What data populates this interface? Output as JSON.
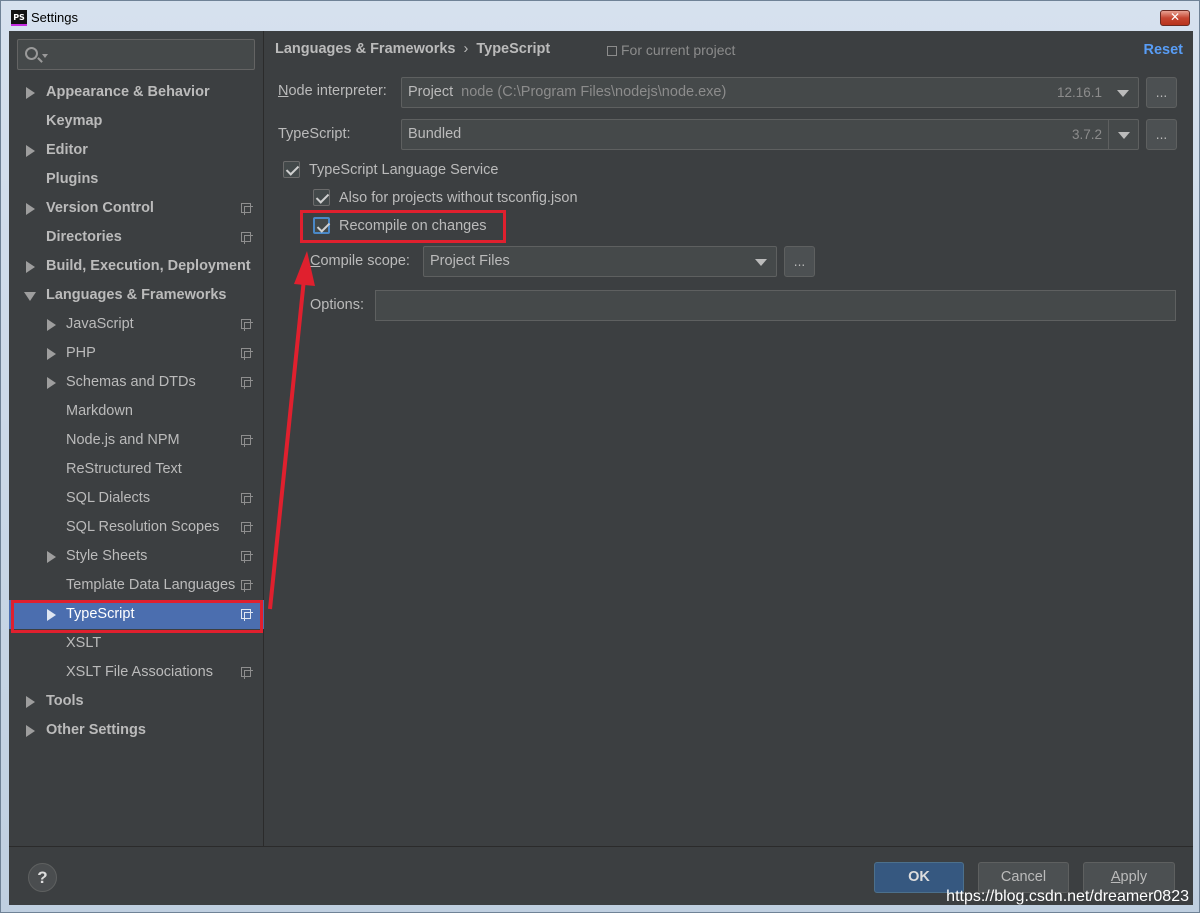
{
  "window": {
    "title": "Settings",
    "app_logo": "PS",
    "close_glyph": "✕"
  },
  "search": {
    "placeholder": "",
    "icon": "search-icon"
  },
  "sidebar": {
    "items": [
      {
        "label": "Appearance & Behavior",
        "expander": "collapsed",
        "project": false,
        "selected": false
      },
      {
        "label": "Keymap",
        "expander": "none",
        "project": false,
        "selected": false
      },
      {
        "label": "Editor",
        "expander": "collapsed",
        "project": false,
        "selected": false
      },
      {
        "label": "Plugins",
        "expander": "none",
        "project": false,
        "selected": false
      },
      {
        "label": "Version Control",
        "expander": "collapsed",
        "project": true,
        "selected": false
      },
      {
        "label": "Directories",
        "expander": "none",
        "project": true,
        "selected": false
      },
      {
        "label": "Build, Execution, Deployment",
        "expander": "collapsed",
        "project": false,
        "selected": false
      },
      {
        "label": "Languages & Frameworks",
        "expander": "expanded",
        "project": false,
        "selected": false
      },
      {
        "label": "JavaScript",
        "expander": "collapsed",
        "project": true,
        "selected": false
      },
      {
        "label": "PHP",
        "expander": "collapsed",
        "project": true,
        "selected": false
      },
      {
        "label": "Schemas and DTDs",
        "expander": "collapsed",
        "project": true,
        "selected": false
      },
      {
        "label": "Markdown",
        "expander": "none",
        "project": false,
        "selected": false
      },
      {
        "label": "Node.js and NPM",
        "expander": "none",
        "project": true,
        "selected": false
      },
      {
        "label": "ReStructured Text",
        "expander": "none",
        "project": false,
        "selected": false
      },
      {
        "label": "SQL Dialects",
        "expander": "none",
        "project": true,
        "selected": false
      },
      {
        "label": "SQL Resolution Scopes",
        "expander": "none",
        "project": true,
        "selected": false
      },
      {
        "label": "Style Sheets",
        "expander": "collapsed",
        "project": true,
        "selected": false
      },
      {
        "label": "Template Data Languages",
        "expander": "none",
        "project": true,
        "selected": false
      },
      {
        "label": "TypeScript",
        "expander": "collapsed",
        "project": true,
        "selected": true
      },
      {
        "label": "XSLT",
        "expander": "none",
        "project": false,
        "selected": false
      },
      {
        "label": "XSLT File Associations",
        "expander": "none",
        "project": true,
        "selected": false
      },
      {
        "label": "Tools",
        "expander": "collapsed",
        "project": false,
        "selected": false
      },
      {
        "label": "Other Settings",
        "expander": "collapsed",
        "project": false,
        "selected": false
      }
    ]
  },
  "header": {
    "breadcrumb_parent": "Languages & Frameworks",
    "breadcrumb_sep": "›",
    "breadcrumb_current": "TypeScript",
    "scope_note": "For current project",
    "reset": "Reset"
  },
  "form": {
    "node_interpreter": {
      "label_first": "N",
      "label_rest": "ode interpreter:",
      "value": "Project",
      "path": "node (C:\\Program Files\\nodejs\\node.exe)",
      "version": "12.16.1",
      "browse": "..."
    },
    "typescript": {
      "label": "TypeScript:",
      "value": "Bundled",
      "version": "3.7.2",
      "browse": "..."
    },
    "language_service": {
      "label": "TypeScript Language Service",
      "checked": true
    },
    "no_tsconfig": {
      "label": "Also for projects without tsconfig.json",
      "checked": true
    },
    "recompile": {
      "label": "Recompile on changes",
      "checked": true
    },
    "compile_scope": {
      "label_first": "C",
      "label_rest": "ompile scope:",
      "value": "Project Files",
      "browse": "..."
    },
    "options": {
      "label": "Options:",
      "value": ""
    }
  },
  "footer": {
    "help": "?",
    "ok": "OK",
    "cancel": "Cancel",
    "apply_first": "A",
    "apply_rest": "pply"
  },
  "watermark": "https://blog.csdn.net/dreamer0823",
  "colors": {
    "background": "#3c3f41",
    "selection": "#4b6eaf",
    "link": "#589df6",
    "annotation": "#e0202e",
    "primary_button": "#365880"
  }
}
